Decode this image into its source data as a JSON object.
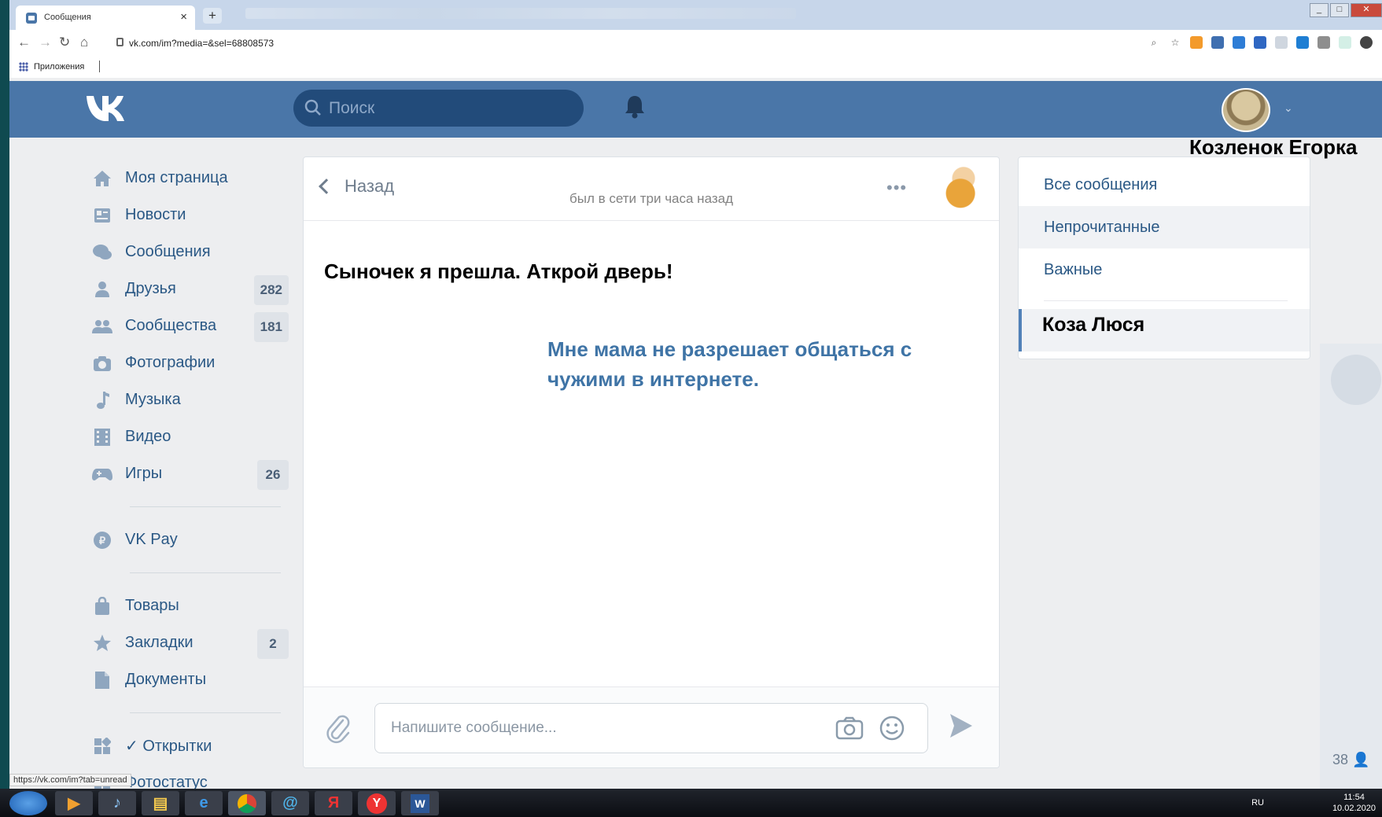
{
  "browser": {
    "tab_title": "Сообщения",
    "tab_close": "×",
    "new_tab": "+",
    "url": "vk.com/im?media=&sel=68808573",
    "bookmarks_label": "Приложения",
    "status_url": "https://vk.com/im?tab=unread"
  },
  "header": {
    "search_placeholder": "Поиск",
    "user_caption": "Козленок Егорка"
  },
  "menu": {
    "items": [
      {
        "label": "Моя страница",
        "icon": "home-icon",
        "badge": ""
      },
      {
        "label": "Новости",
        "icon": "news-icon",
        "badge": ""
      },
      {
        "label": "Сообщения",
        "icon": "messages-icon",
        "badge": ""
      },
      {
        "label": "Друзья",
        "icon": "friends-icon",
        "badge": "282"
      },
      {
        "label": "Сообщества",
        "icon": "groups-icon",
        "badge": "181"
      },
      {
        "label": "Фотографии",
        "icon": "camera-icon",
        "badge": ""
      },
      {
        "label": "Музыка",
        "icon": "music-icon",
        "badge": ""
      },
      {
        "label": "Видео",
        "icon": "video-icon",
        "badge": ""
      },
      {
        "label": "Игры",
        "icon": "gamepad-icon",
        "badge": "26"
      },
      {
        "label": "VK Pay",
        "icon": "vkpay-icon",
        "badge": ""
      },
      {
        "label": "Товары",
        "icon": "bag-icon",
        "badge": ""
      },
      {
        "label": "Закладки",
        "icon": "star-icon",
        "badge": "2"
      },
      {
        "label": "Документы",
        "icon": "document-icon",
        "badge": ""
      },
      {
        "label": "✓ Открытки",
        "icon": "apps-icon",
        "badge": ""
      },
      {
        "label": "Фотостатус",
        "icon": "apps-icon",
        "badge": ""
      }
    ]
  },
  "chat": {
    "back_label": "Назад",
    "status": "был в сети три часа назад",
    "incoming_message": "Сыночек я прешла.  Аткрой дверь!",
    "outgoing_message": "Мне мама не разрешает общаться с чужими в интернете.",
    "input_placeholder": "Напишите сообщение..."
  },
  "filters": {
    "all": "Все сообщения",
    "unread": "Непрочитанные",
    "important": "Важные",
    "folder": "Коза Люся"
  },
  "online_count": "38",
  "taskbar": {
    "lang": "RU",
    "time": "11:54",
    "date": "10.02.2020"
  },
  "colors": {
    "vk_blue": "#4a76a8",
    "link": "#2a5885",
    "outgoing_text": "#3f74a6"
  }
}
